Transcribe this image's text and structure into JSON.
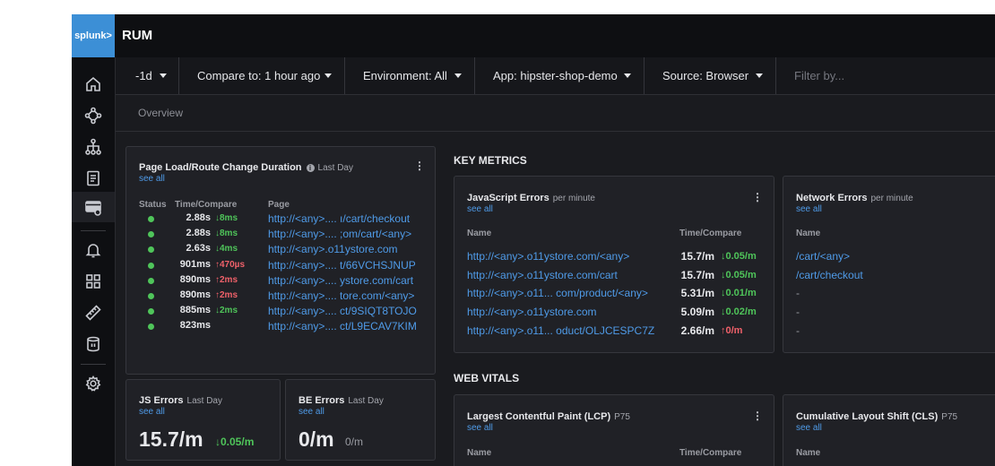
{
  "header": {
    "logo_text": "splunk>",
    "title": "RUM"
  },
  "sidebar": {
    "items": [
      {
        "icon": "home-icon"
      },
      {
        "icon": "service-map-icon"
      },
      {
        "icon": "hierarchy-icon"
      },
      {
        "icon": "document-icon"
      },
      {
        "icon": "rum-browser-icon",
        "active": true
      },
      {
        "icon": "bell-icon"
      },
      {
        "icon": "dashboards-icon"
      },
      {
        "icon": "ruler-icon"
      },
      {
        "icon": "database-icon"
      },
      {
        "icon": "gear-icon"
      }
    ]
  },
  "filters": {
    "time": "-1d",
    "compare": "Compare to: 1 hour ago",
    "environment": "Environment: All",
    "app": "App: hipster-shop-demo",
    "source": "Source: Browser",
    "filter_placeholder": "Filter by..."
  },
  "tabs": {
    "overview": "Overview"
  },
  "page_load": {
    "title": "Page Load/Route Change Duration",
    "subtitle": "Last Day",
    "see_all": "see all",
    "headers": {
      "status": "Status",
      "time": "Time/Compare",
      "page": "Page"
    },
    "rows": [
      {
        "time": "2.88s",
        "delta": "↓8ms",
        "dir": "down",
        "page": "http://<any>.... ı/cart/checkout"
      },
      {
        "time": "2.88s",
        "delta": "↓8ms",
        "dir": "down",
        "page": "http://<any>.... ;om/cart/<any>"
      },
      {
        "time": "2.63s",
        "delta": "↓4ms",
        "dir": "down",
        "page": "http://<any>.o11ystore.com"
      },
      {
        "time": "901ms",
        "delta": "↑470µs",
        "dir": "up",
        "page": "http://<any>.... t/66VCHSJNUP"
      },
      {
        "time": "890ms",
        "delta": "↑2ms",
        "dir": "up",
        "page": "http://<any>.... ystore.com/cart"
      },
      {
        "time": "890ms",
        "delta": "↑2ms",
        "dir": "up",
        "page": "http://<any>.... tore.com/<any>"
      },
      {
        "time": "885ms",
        "delta": "↓2ms",
        "dir": "down",
        "page": "http://<any>.... ct/9SIQT8TOJO"
      },
      {
        "time": "823ms",
        "delta": "",
        "dir": "down",
        "page": "http://<any>.... ct/L9ECAV7KIM"
      }
    ],
    "status_color": "#4fc55a"
  },
  "js_errors_card": {
    "title": "JS Errors",
    "subtitle": "Last Day",
    "see_all": "see all",
    "value": "15.7/m",
    "delta": "↓0.05/m"
  },
  "be_errors_card": {
    "title": "BE Errors",
    "subtitle": "Last Day",
    "see_all": "see all",
    "value": "0/m",
    "secondary": "0/m"
  },
  "key_metrics": {
    "section_title": "KEY METRICS",
    "js_errors": {
      "title": "JavaScript Errors",
      "subtitle": "per minute",
      "see_all": "see all",
      "headers": {
        "name": "Name",
        "time": "Time/Compare"
      },
      "rows": [
        {
          "name": "http://<any>.o11ystore.com/<any>",
          "value": "15.7/m",
          "delta": "↓0.05/m",
          "dir": "down"
        },
        {
          "name": "http://<any>.o11ystore.com/cart",
          "value": "15.7/m",
          "delta": "↓0.05/m",
          "dir": "down"
        },
        {
          "name": "http://<any>.o11... com/product/<any>",
          "value": "5.31/m",
          "delta": "↓0.01/m",
          "dir": "down"
        },
        {
          "name": "http://<any>.o11ystore.com",
          "value": "5.09/m",
          "delta": "↓0.02/m",
          "dir": "down"
        },
        {
          "name": "http://<any>.o11... oduct/OLJCESPC7Z",
          "value": "2.66/m",
          "delta": "↑0/m",
          "dir": "up"
        }
      ]
    },
    "network_errors": {
      "title": "Network Errors",
      "subtitle": "per minute",
      "see_all": "see all",
      "headers": {
        "name": "Name"
      },
      "rows": [
        "/cart/<any>",
        "/cart/checkout",
        "-",
        "-",
        "-"
      ]
    }
  },
  "web_vitals": {
    "section_title": "WEB VITALS",
    "lcp": {
      "title": "Largest Contentful Paint (LCP)",
      "subtitle": "P75",
      "see_all": "see all",
      "headers": {
        "name": "Name",
        "time": "Time/Compare"
      }
    },
    "cls": {
      "title": "Cumulative Layout Shift (CLS)",
      "subtitle": "P75",
      "see_all": "see all",
      "headers": {
        "name": "Name"
      }
    }
  },
  "colors": {
    "accent": "#4f9be8",
    "good": "#4fc55a",
    "bad": "#f0616a",
    "logo_bg": "#3c8fd6"
  }
}
